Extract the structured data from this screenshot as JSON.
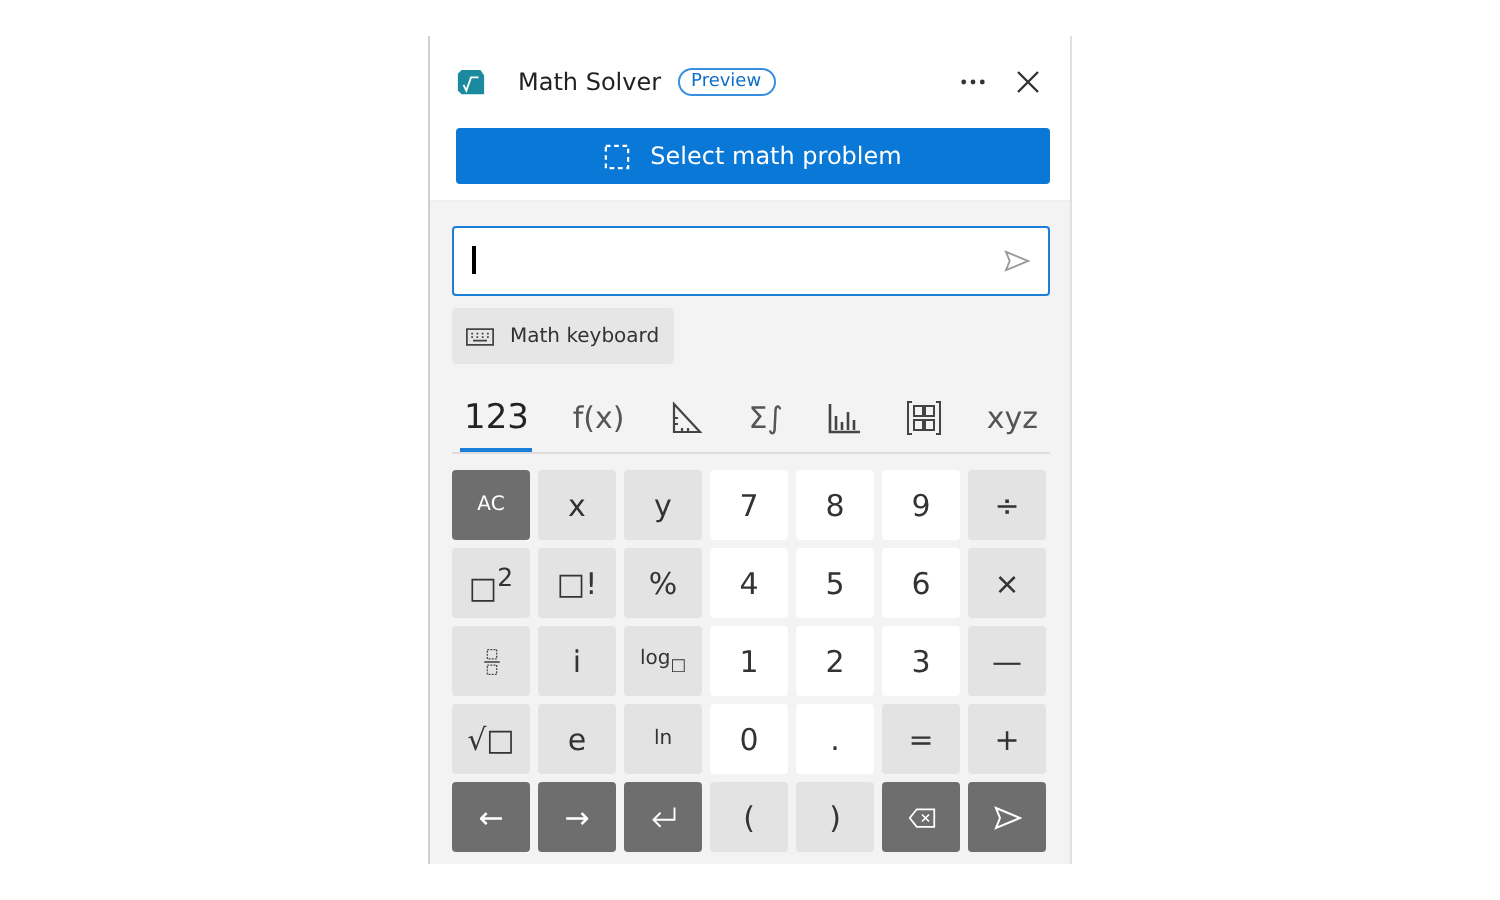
{
  "window": {
    "title": "Math Solver",
    "badge": "Preview"
  },
  "select_button": {
    "label": "Select math problem"
  },
  "keyboard_button": {
    "label": "Math keyboard"
  },
  "tabs": [
    {
      "kind": "text",
      "label": "123",
      "selected": true
    },
    {
      "kind": "text",
      "label": "f(x)",
      "selected": false
    },
    {
      "kind": "triangle",
      "selected": false
    },
    {
      "kind": "text",
      "label": "Σ∫",
      "selected": false
    },
    {
      "kind": "chart",
      "selected": false
    },
    {
      "kind": "matrix",
      "selected": false
    },
    {
      "kind": "text",
      "label": "xyz",
      "selected": false
    }
  ],
  "keys": [
    {
      "kind": "dark",
      "label": "AC"
    },
    {
      "kind": "gray",
      "label": "x"
    },
    {
      "kind": "gray",
      "label": "y"
    },
    {
      "kind": "white",
      "label": "7"
    },
    {
      "kind": "white",
      "label": "8"
    },
    {
      "kind": "white",
      "label": "9"
    },
    {
      "kind": "gray",
      "label": "÷"
    },
    {
      "kind": "gray",
      "label": "□$^{2}$"
    },
    {
      "kind": "gray",
      "label": "□!"
    },
    {
      "kind": "gray",
      "label": "%"
    },
    {
      "kind": "white",
      "label": "4"
    },
    {
      "kind": "white",
      "label": "5"
    },
    {
      "kind": "white",
      "label": "6"
    },
    {
      "kind": "gray",
      "label": "×"
    },
    {
      "kind": "gray"
    },
    {
      "kind": "gray",
      "label": "i"
    },
    {
      "kind": "gray",
      "label": "log$_{□}$"
    },
    {
      "kind": "white",
      "label": "1"
    },
    {
      "kind": "white",
      "label": "2"
    },
    {
      "kind": "white",
      "label": "3"
    },
    {
      "kind": "gray",
      "label": "—"
    },
    {
      "kind": "gray",
      "label": "√□"
    },
    {
      "kind": "gray",
      "label": "e"
    },
    {
      "kind": "gray",
      "label": "ln"
    },
    {
      "kind": "white",
      "label": "0"
    },
    {
      "kind": "white",
      "label": "."
    },
    {
      "kind": "gray",
      "label": "="
    },
    {
      "kind": "gray",
      "label": "+"
    },
    {
      "kind": "dark",
      "label": "←"
    },
    {
      "kind": "dark",
      "label": "→"
    },
    {
      "kind": "dark"
    },
    {
      "kind": "gray",
      "label": "("
    },
    {
      "kind": "gray",
      "label": ")"
    },
    {
      "kind": "dark"
    },
    {
      "kind": "dark"
    }
  ]
}
